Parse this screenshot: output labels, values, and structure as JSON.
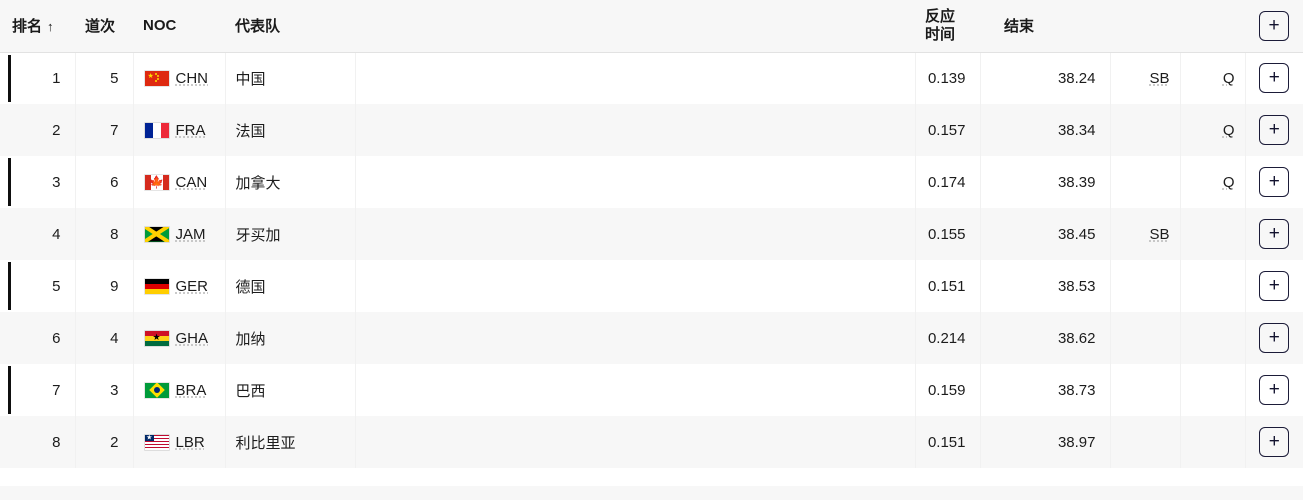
{
  "table": {
    "columns": [
      {
        "key": "rank",
        "label": "排名",
        "sort_indicator": "↑",
        "sorted": true
      },
      {
        "key": "lane",
        "label": "道次"
      },
      {
        "key": "noc",
        "label": "NOC"
      },
      {
        "key": "team",
        "label": "代表队"
      },
      {
        "key": "spacer",
        "label": ""
      },
      {
        "key": "react",
        "label_line1": "反应",
        "label_line2": "时间"
      },
      {
        "key": "finish",
        "label": "结束"
      },
      {
        "key": "mark1",
        "label": ""
      },
      {
        "key": "mark2",
        "label": ""
      },
      {
        "key": "expand",
        "label": "+"
      }
    ],
    "header_expand_label": "+",
    "row_expand_label": "+",
    "rows": [
      {
        "rank": "1",
        "lane": "5",
        "noc": "CHN",
        "flag": "flag-china",
        "team": "中国",
        "reaction_time": "0.139",
        "finish": "38.24",
        "mark1": "SB",
        "mark2": "Q",
        "expand_label": "+",
        "highlighted": true
      },
      {
        "rank": "2",
        "lane": "7",
        "noc": "FRA",
        "flag": "flag-france",
        "team": "法国",
        "reaction_time": "0.157",
        "finish": "38.34",
        "mark1": "",
        "mark2": "Q",
        "expand_label": "+",
        "highlighted": false
      },
      {
        "rank": "3",
        "lane": "6",
        "noc": "CAN",
        "flag": "flag-canada",
        "team": "加拿大",
        "reaction_time": "0.174",
        "finish": "38.39",
        "mark1": "",
        "mark2": "Q",
        "expand_label": "+",
        "highlighted": true
      },
      {
        "rank": "4",
        "lane": "8",
        "noc": "JAM",
        "flag": "flag-jamaica",
        "team": "牙买加",
        "reaction_time": "0.155",
        "finish": "38.45",
        "mark1": "SB",
        "mark2": "",
        "expand_label": "+",
        "highlighted": false
      },
      {
        "rank": "5",
        "lane": "9",
        "noc": "GER",
        "flag": "flag-germany",
        "team": "德国",
        "reaction_time": "0.151",
        "finish": "38.53",
        "mark1": "",
        "mark2": "",
        "expand_label": "+",
        "highlighted": true
      },
      {
        "rank": "6",
        "lane": "4",
        "noc": "GHA",
        "flag": "flag-ghana",
        "team": "加纳",
        "reaction_time": "0.214",
        "finish": "38.62",
        "mark1": "",
        "mark2": "",
        "expand_label": "+",
        "highlighted": false
      },
      {
        "rank": "7",
        "lane": "3",
        "noc": "BRA",
        "flag": "flag-brazil",
        "team": "巴西",
        "reaction_time": "0.159",
        "finish": "38.73",
        "mark1": "",
        "mark2": "",
        "expand_label": "+",
        "highlighted": true
      },
      {
        "rank": "8",
        "lane": "2",
        "noc": "LBR",
        "flag": "flag-liberia",
        "team": "利比里亚",
        "reaction_time": "0.151",
        "finish": "38.97",
        "mark1": "",
        "mark2": "",
        "expand_label": "+",
        "highlighted": false
      }
    ]
  },
  "colors": {
    "row_odd_bg": "#ffffff",
    "row_even_bg": "#f7f7f7",
    "header_bg": "#f7f7f7",
    "rank_marker": "#0f0f0f",
    "text": "#1c1c1c",
    "button_border": "#1b1b38",
    "divider": "#f1f1f1"
  }
}
